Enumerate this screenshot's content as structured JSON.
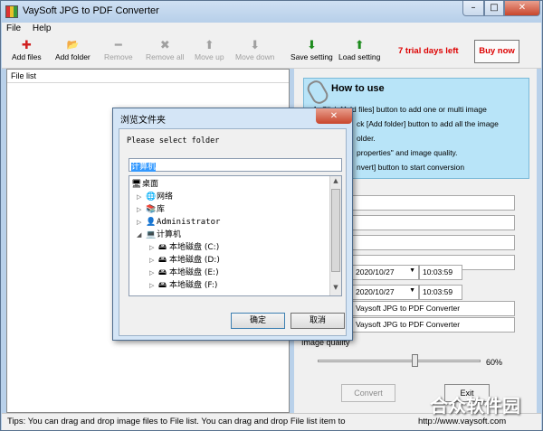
{
  "window": {
    "title": "VaySoft JPG to PDF Converter",
    "controls": {
      "minimize": "–",
      "maximize": "□",
      "close": "✕"
    }
  },
  "menu": [
    "File",
    "Help"
  ],
  "toolbar": {
    "buttons": [
      {
        "label": "Add files",
        "icon": "plus-icon",
        "glyph": "✚",
        "enabled": true,
        "color": "#d02020"
      },
      {
        "label": "Add folder",
        "icon": "folder-icon",
        "glyph": "📂",
        "enabled": true,
        "color": "#d8a020"
      },
      {
        "label": "Remove",
        "icon": "minus-icon",
        "glyph": "━",
        "enabled": false,
        "color": "#a0a0a0"
      },
      {
        "label": "Remove all",
        "icon": "x-icon",
        "glyph": "✖",
        "enabled": false,
        "color": "#a0a0a0"
      },
      {
        "label": "Move up",
        "icon": "arrow-up-icon",
        "glyph": "⬆",
        "enabled": false,
        "color": "#a0a0a0"
      },
      {
        "label": "Move down",
        "icon": "arrow-down-icon",
        "glyph": "⬇",
        "enabled": false,
        "color": "#a0a0a0"
      },
      {
        "label": "Save setting",
        "icon": "download-icon",
        "glyph": "⬇",
        "enabled": true,
        "color": "#1e8c1e"
      },
      {
        "label": "Load setting",
        "icon": "upload-icon",
        "glyph": "⬆",
        "enabled": true,
        "color": "#1e8c1e"
      }
    ],
    "trial_text": "7 trial days left",
    "buy_label": "Buy now"
  },
  "file_list": {
    "header": "File list"
  },
  "how_to_use": {
    "title": "How to use",
    "lines": [
      "1. Click [Add files] button to add one or multi image",
      "ck [Add folder] button to add all the image",
      "older.",
      "properties\" and image quality.",
      "nvert] button to start conversion"
    ]
  },
  "properties": {
    "date1": "2020/10/27",
    "time1": "10:03:59",
    "date2": "2020/10/27",
    "time2": "10:03:59",
    "producer": "Vaysoft JPG to PDF Converter",
    "creator": "Vaysoft JPG to PDF Converter"
  },
  "image_quality": {
    "label": "Image quality",
    "value": 60,
    "value_text": "60%"
  },
  "buttons": {
    "convert": "Convert",
    "exit": "Exit"
  },
  "status": {
    "tips": "Tips: You can drag and drop image files to File list. You can drag and drop File list item to",
    "url": "http://www.vaysoft.com"
  },
  "watermark": "合众软件园",
  "dialog": {
    "title": "浏览文件夹",
    "close": "✕",
    "prompt": "Please select folder",
    "path": "计算机",
    "tree": [
      {
        "label": "桌面",
        "icon": "desktop-icon",
        "glyph": "🖥",
        "level": 0,
        "expander": ""
      },
      {
        "label": "网络",
        "icon": "network-icon",
        "glyph": "🌐",
        "level": 1,
        "expander": "▷"
      },
      {
        "label": "库",
        "icon": "library-icon",
        "glyph": "📚",
        "level": 1,
        "expander": "▷"
      },
      {
        "label": "Administrator",
        "icon": "user-icon",
        "glyph": "👤",
        "level": 1,
        "expander": "▷"
      },
      {
        "label": "计算机",
        "icon": "computer-icon",
        "glyph": "💻",
        "level": 1,
        "expander": "◢"
      },
      {
        "label": "本地磁盘 (C:)",
        "icon": "drive-icon",
        "glyph": "🖴",
        "level": 2,
        "expander": "▷"
      },
      {
        "label": "本地磁盘 (D:)",
        "icon": "drive-icon",
        "glyph": "🖴",
        "level": 2,
        "expander": "▷"
      },
      {
        "label": "本地磁盘 (E:)",
        "icon": "drive-icon",
        "glyph": "🖴",
        "level": 2,
        "expander": "▷"
      },
      {
        "label": "本地磁盘 (F:)",
        "icon": "drive-icon",
        "glyph": "🖴",
        "level": 2,
        "expander": "▷"
      }
    ],
    "ok": "确定",
    "cancel": "取消"
  }
}
